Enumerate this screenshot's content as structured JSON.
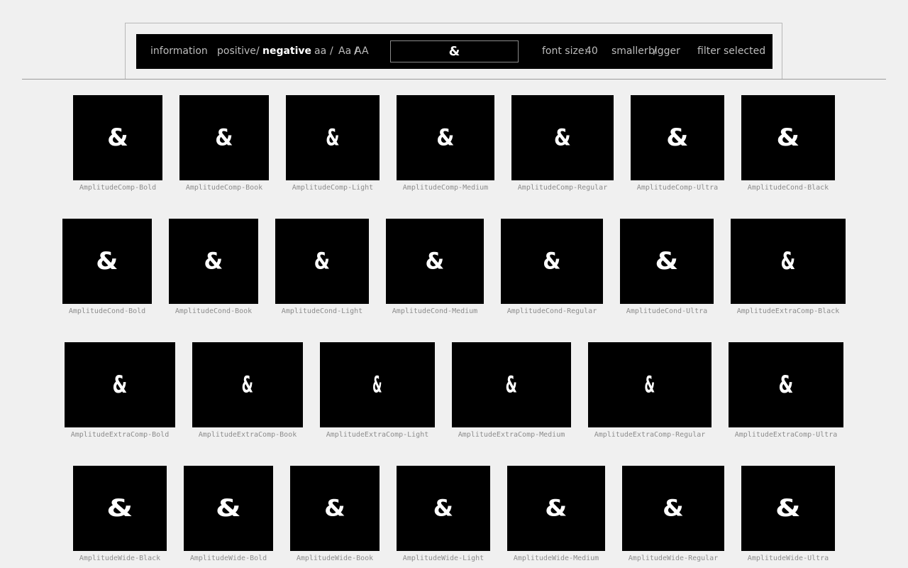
{
  "toolbar": {
    "information": "information",
    "positive": "positive",
    "slash": "/",
    "negative": "negative",
    "case_lower": "aa",
    "case_title": "Aa",
    "case_upper": "AA",
    "sample_text": "&",
    "font_size_label": "font size:",
    "font_size_value": "40",
    "smaller": "smaller",
    "bigger": "bigger",
    "filter_selected": "filter selected"
  },
  "fonts": [
    {
      "name": "AmplitudeComp-Bold",
      "glyph": "&"
    },
    {
      "name": "AmplitudeComp-Book",
      "glyph": "&"
    },
    {
      "name": "AmplitudeComp-Light",
      "glyph": "&"
    },
    {
      "name": "AmplitudeComp-Medium",
      "glyph": "&"
    },
    {
      "name": "AmplitudeComp-Regular",
      "glyph": "&"
    },
    {
      "name": "AmplitudeComp-Ultra",
      "glyph": "&"
    },
    {
      "name": "AmplitudeCond-Black",
      "glyph": "&"
    },
    {
      "name": "AmplitudeCond-Bold",
      "glyph": "&"
    },
    {
      "name": "AmplitudeCond-Book",
      "glyph": "&"
    },
    {
      "name": "AmplitudeCond-Light",
      "glyph": "&"
    },
    {
      "name": "AmplitudeCond-Medium",
      "glyph": "&"
    },
    {
      "name": "AmplitudeCond-Regular",
      "glyph": "&"
    },
    {
      "name": "AmplitudeCond-Ultra",
      "glyph": "&"
    },
    {
      "name": "AmplitudeExtraComp-Black",
      "glyph": "&"
    },
    {
      "name": "AmplitudeExtraComp-Bold",
      "glyph": "&"
    },
    {
      "name": "AmplitudeExtraComp-Book",
      "glyph": "&"
    },
    {
      "name": "AmplitudeExtraComp-Light",
      "glyph": "&"
    },
    {
      "name": "AmplitudeExtraComp-Medium",
      "glyph": "&"
    },
    {
      "name": "AmplitudeExtraComp-Regular",
      "glyph": "&"
    },
    {
      "name": "AmplitudeExtraComp-Ultra",
      "glyph": "&"
    },
    {
      "name": "AmplitudeWide-Black",
      "glyph": "&"
    },
    {
      "name": "AmplitudeWide-Bold",
      "glyph": "&"
    },
    {
      "name": "AmplitudeWide-Book",
      "glyph": "&"
    },
    {
      "name": "AmplitudeWide-Light",
      "glyph": "&"
    },
    {
      "name": "AmplitudeWide-Medium",
      "glyph": "&"
    },
    {
      "name": "AmplitudeWide-Regular",
      "glyph": "&"
    },
    {
      "name": "AmplitudeWide-Ultra",
      "glyph": "&"
    }
  ]
}
